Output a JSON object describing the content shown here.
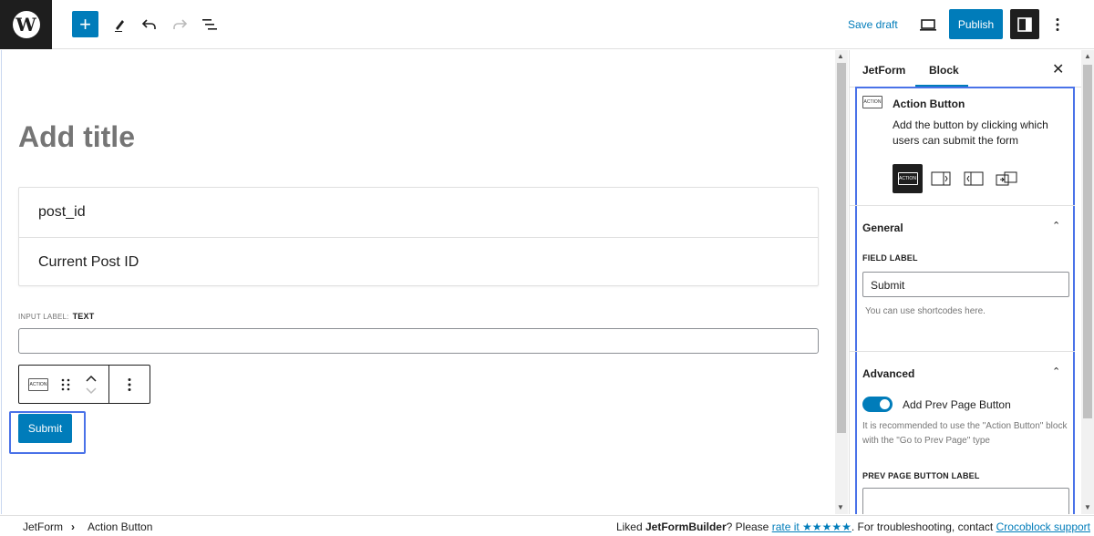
{
  "topbar": {
    "save_draft": "Save draft",
    "publish": "Publish",
    "plus": "+"
  },
  "editor": {
    "title_placeholder": "Add title",
    "hidden_fields": [
      "post_id",
      "Current Post ID"
    ],
    "input_label_prefix": "INPUT LABEL:",
    "input_label_value": "TEXT",
    "block_icon_text": "ACTION",
    "submit_label": "Submit"
  },
  "sidebar": {
    "tabs": [
      "JetForm",
      "Block"
    ],
    "active_tab": "Block",
    "block_icon_text": "ACTION",
    "block_name": "Action Button",
    "block_description": "Add the button by clicking which users can submit the form",
    "general": {
      "title": "General",
      "field_label": "FIELD LABEL",
      "field_value": "Submit",
      "help": "You can use shortcodes here."
    },
    "advanced": {
      "title": "Advanced",
      "toggle_label": "Add Prev Page Button",
      "toggle_on": true,
      "toggle_help": "It is recommended to use the \"Action Button\" block with the \"Go to Prev Page\" type",
      "prev_label": "PREV PAGE BUTTON LABEL"
    }
  },
  "footer": {
    "breadcrumb": [
      "JetForm",
      "Action Button"
    ],
    "separator": "›",
    "note_prefix": "Liked ",
    "note_brand": "JetFormBuilder",
    "note_middle": "? Please ",
    "rate_link": "rate it ★★★★★",
    "note_after": ". For troubleshooting, contact ",
    "support_link": "Crocoblock support"
  },
  "colors": {
    "accent": "#007cba",
    "highlight_outline": "#4a72e8",
    "dark": "#1e1e1e"
  }
}
